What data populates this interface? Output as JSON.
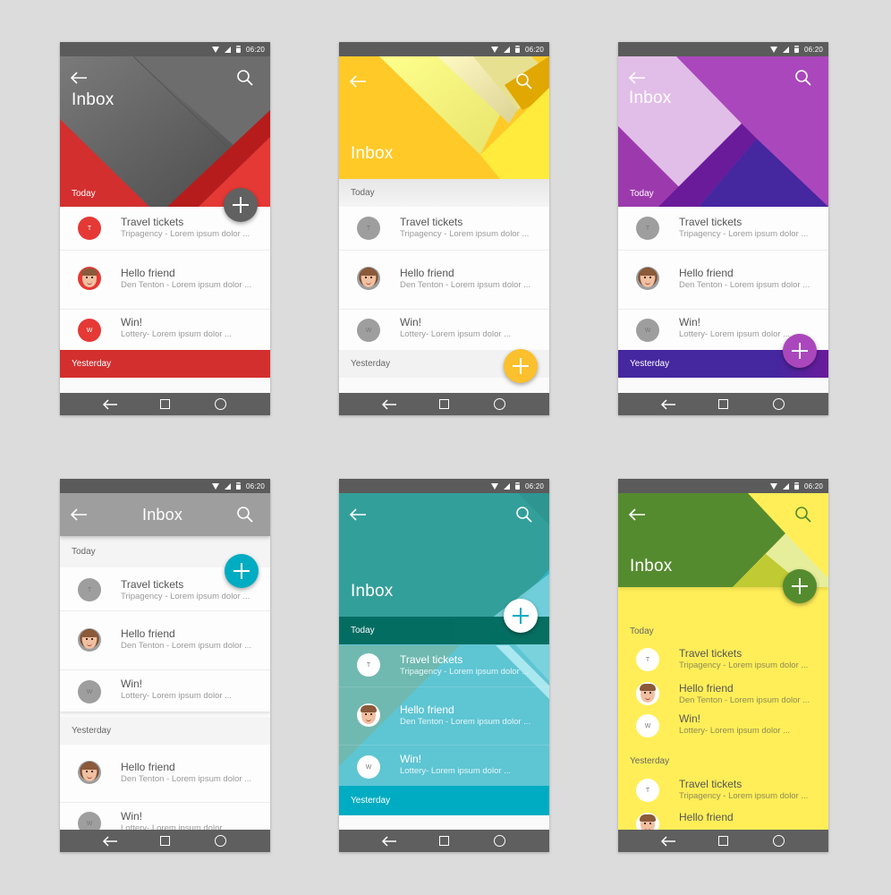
{
  "status_bar": {
    "time": "06:20"
  },
  "header": {
    "title": "Inbox"
  },
  "sections": {
    "today": "Today",
    "yesterday": "Yesterday"
  },
  "messages": {
    "travel": {
      "initial": "T",
      "title": "Travel tickets",
      "subtitle": "Tripagency - Lorem ipsum dolor ..."
    },
    "hello": {
      "title": "Hello friend",
      "subtitle": "Den Tenton - Lorem ipsum dolor ..."
    },
    "win": {
      "initial": "W",
      "title": "Win!",
      "subtitle": "Lottery- Lorem ipsum dolor ..."
    }
  },
  "icons": {
    "back": "arrow-left-icon",
    "search": "search-icon",
    "fab": "plus-icon",
    "nav_back": "nav-back-icon",
    "nav_home": "nav-square-icon",
    "nav_recent": "nav-circle-icon"
  },
  "themes": [
    {
      "name": "red-grey",
      "primary": "#616161",
      "accent": "#e53935",
      "fab": "#616161"
    },
    {
      "name": "amber",
      "primary": "#ffca28",
      "accent": "#ffee58",
      "fab": "#fbc02d"
    },
    {
      "name": "purple",
      "primary": "#ab47bc",
      "accent": "#4527a0",
      "fab": "#ab47bc"
    },
    {
      "name": "grey-cyan",
      "primary": "#9e9e9e",
      "accent": "#00acc1",
      "fab": "#00acc1"
    },
    {
      "name": "teal",
      "primary": "#26a69a",
      "accent": "#4dd0e1",
      "fab": "#ffffff"
    },
    {
      "name": "green-yellow",
      "primary": "#558b2f",
      "accent": "#ffee58",
      "fab": "#558b2f"
    }
  ]
}
